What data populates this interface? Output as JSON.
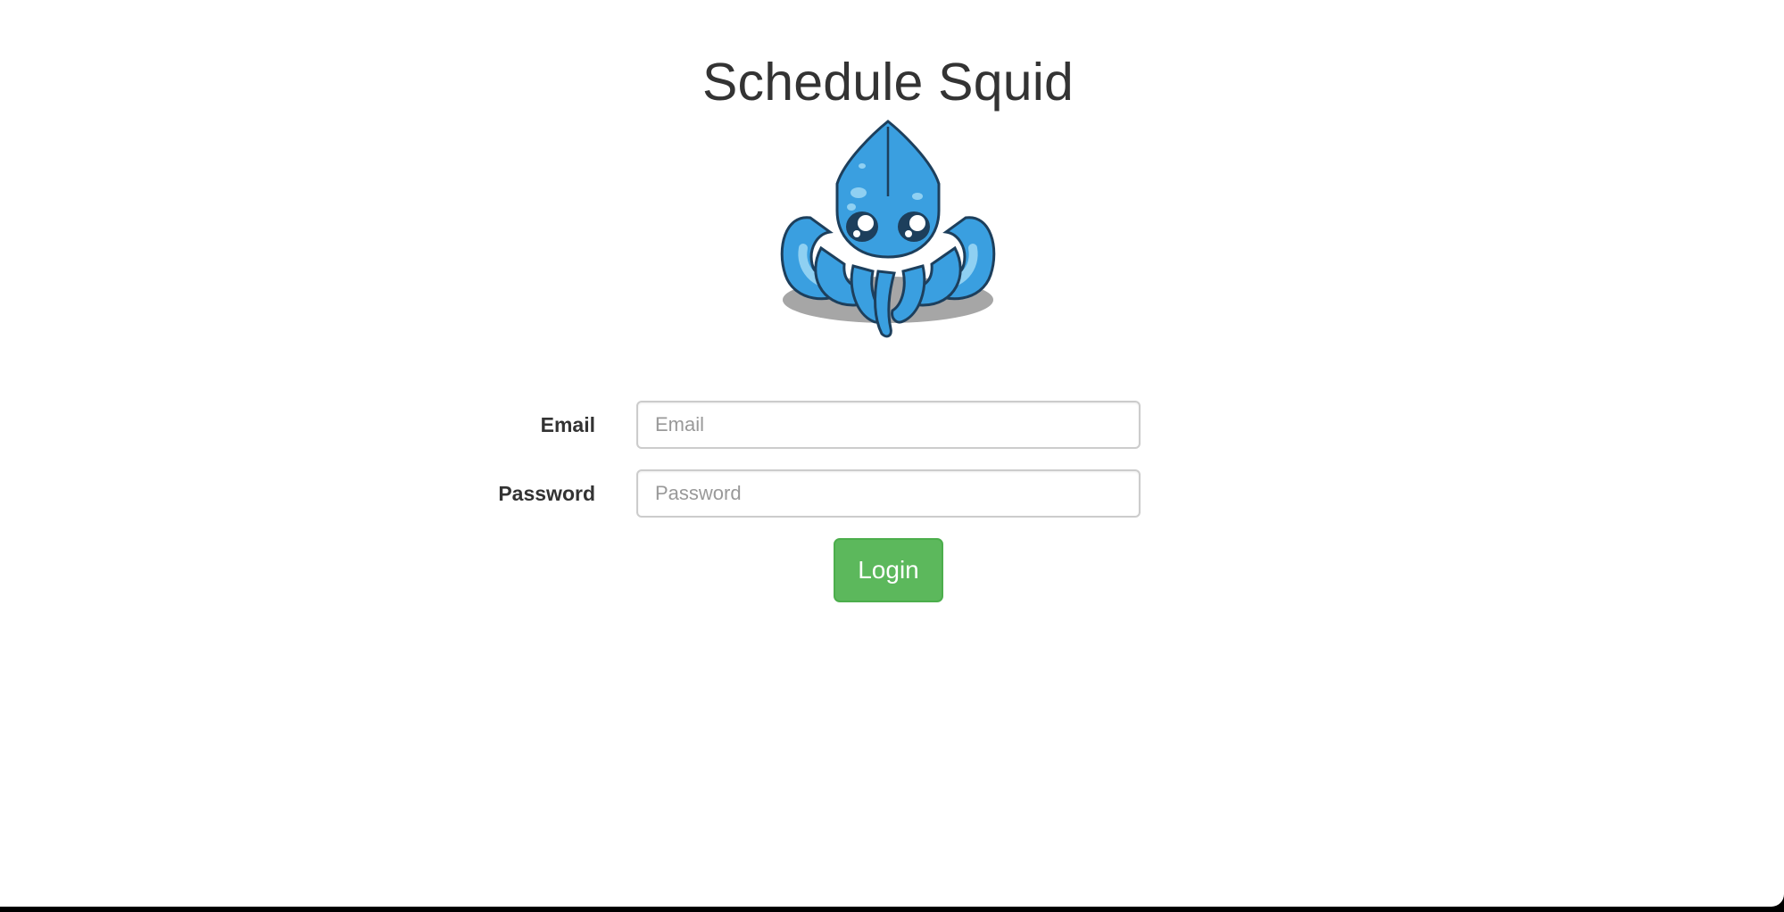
{
  "page": {
    "title": "Schedule Squid"
  },
  "logo": {
    "icon": "squid-mascot-icon",
    "colors": {
      "body": "#3a9fe0",
      "body_light": "#8fd0f2",
      "outline": "#1d3f5c",
      "shadow": "#a6a6a6"
    }
  },
  "form": {
    "email": {
      "label": "Email",
      "placeholder": "Email",
      "value": ""
    },
    "password": {
      "label": "Password",
      "placeholder": "Password",
      "value": ""
    },
    "submit": {
      "label": "Login",
      "color": "#5cb85c"
    }
  }
}
